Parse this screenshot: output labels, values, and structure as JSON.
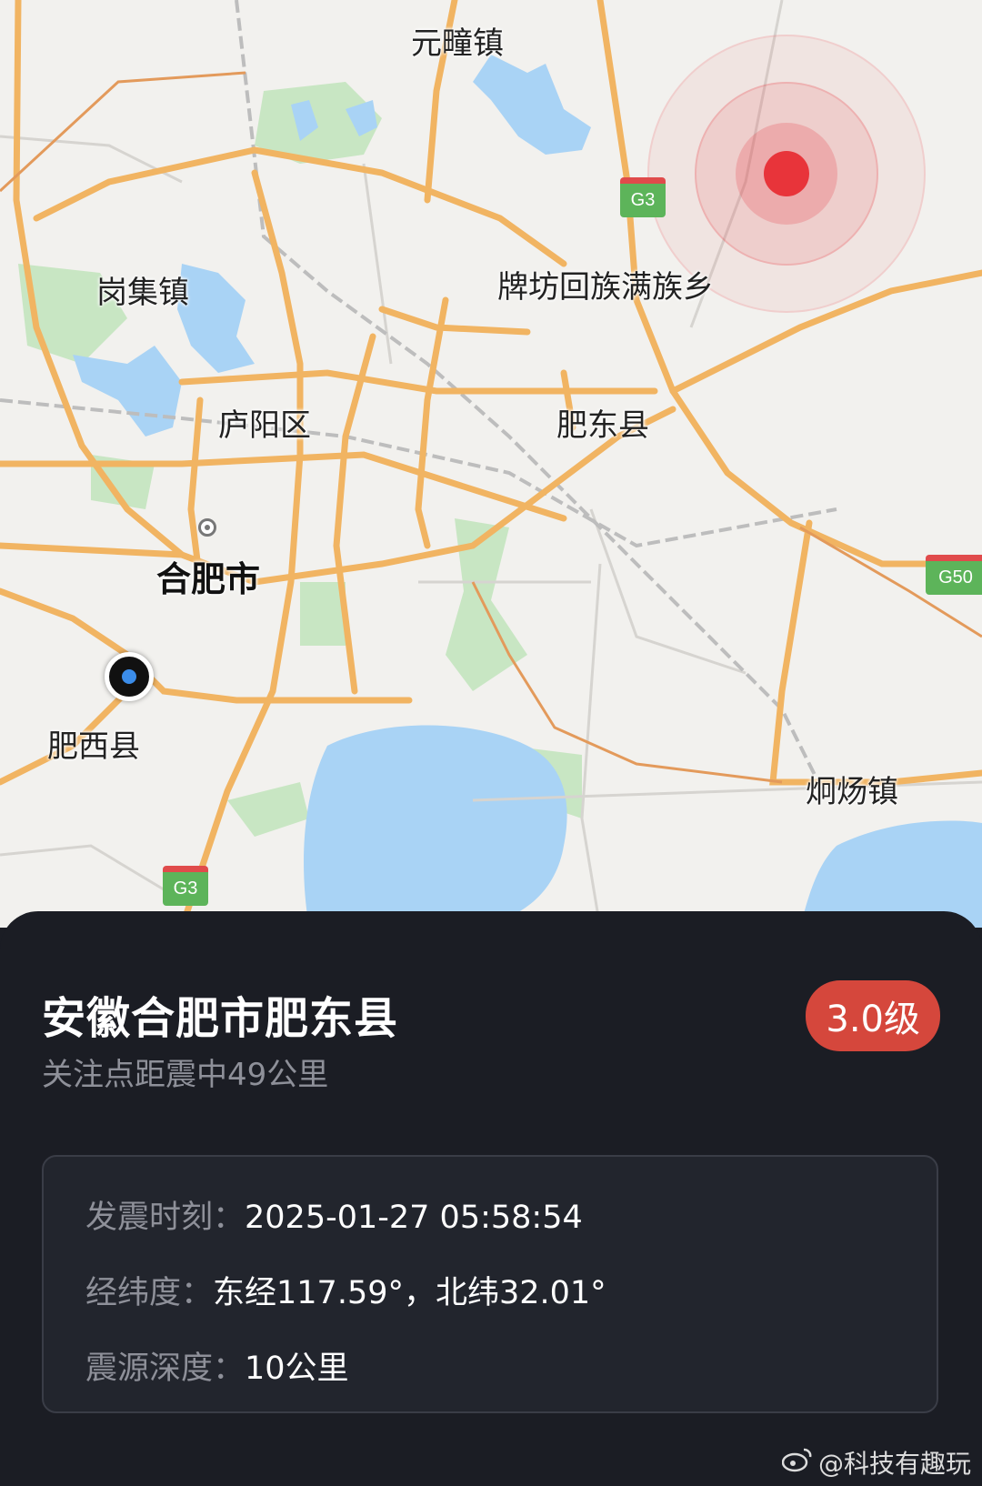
{
  "map": {
    "places": {
      "yuantong": "元疃镇",
      "gangji": "岗集镇",
      "paifang": "牌坊回族满族乡",
      "luyang": "庐阳区",
      "feidong": "肥东县",
      "hefei": "合肥市",
      "feixi": "肥西县",
      "tongyang": "炯炀镇"
    },
    "shields": {
      "g3_top": "G3",
      "g3_bottom": "G3",
      "g50": "G50"
    },
    "colors": {
      "land": "#f2f1ee",
      "water": "#a9d3f5",
      "green": "#c8e6c3",
      "highway": "#f1b462",
      "epicenter": "#e8343a"
    }
  },
  "panel": {
    "location_title": "安徽合肥市肥东县",
    "magnitude_badge": "3.0级",
    "distance_text": "关注点距震中49公里",
    "rows": [
      {
        "label": "发震时刻：",
        "value": "2025-01-27 05:58:54"
      },
      {
        "label": "经纬度：",
        "value": "东经117.59°，北纬32.01°"
      },
      {
        "label": "震源深度：",
        "value": "10公里"
      }
    ]
  },
  "watermark": "@科技有趣玩"
}
